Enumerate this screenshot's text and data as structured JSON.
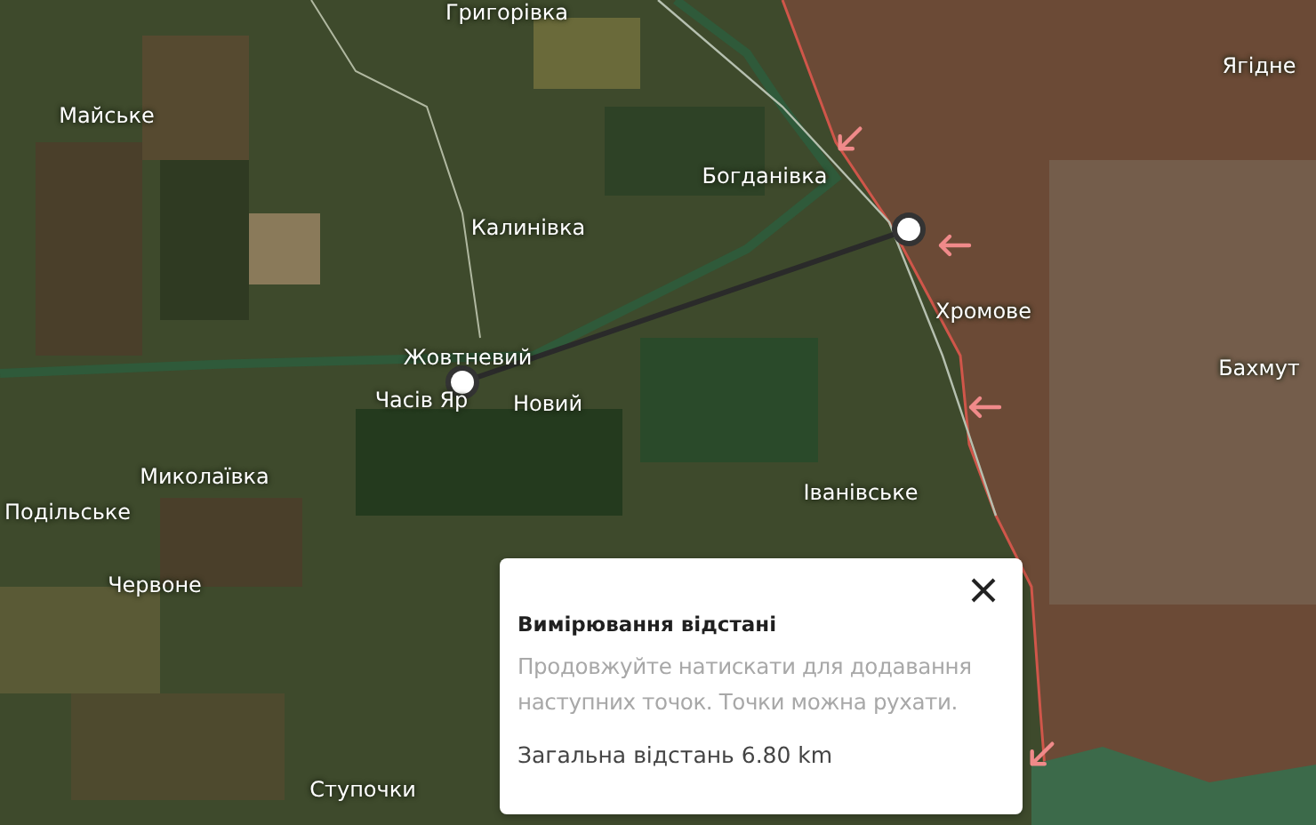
{
  "map": {
    "places": [
      {
        "name": "Григорівка"
      },
      {
        "name": "Ягідне"
      },
      {
        "name": "Майське"
      },
      {
        "name": "Богданівка"
      },
      {
        "name": "Калинівка"
      },
      {
        "name": "Хромове"
      },
      {
        "name": "Жовтневий"
      },
      {
        "name": "Бахмут"
      },
      {
        "name": "Часів Яр"
      },
      {
        "name": "Новий"
      },
      {
        "name": "Миколаївка"
      },
      {
        "name": "Іванівське"
      },
      {
        "name": "Подільське"
      },
      {
        "name": "Червоне"
      },
      {
        "name": "Ступочки"
      }
    ]
  },
  "measure_panel": {
    "title": "Вимірювання відстані",
    "hint": "Продовжуйте натискати для додавання наступних точок. Точки можна рухати.",
    "total": "Загальна відстань 6.80 km"
  }
}
